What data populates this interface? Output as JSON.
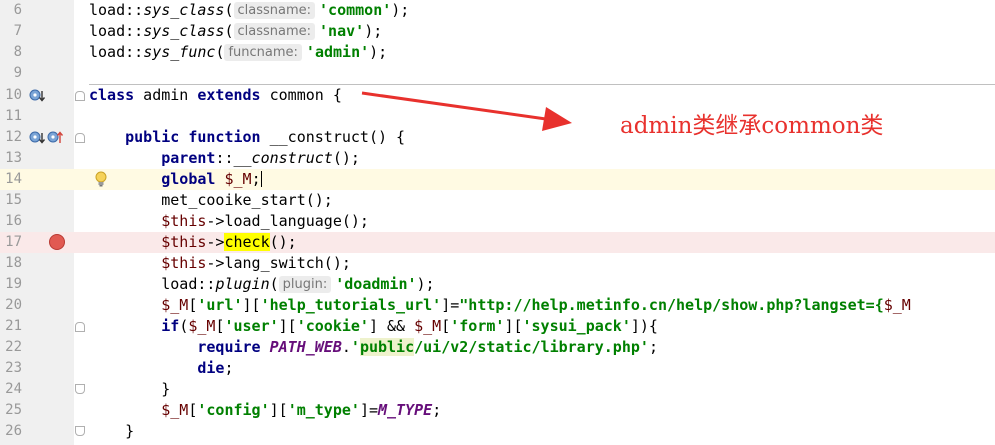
{
  "annotation": {
    "text": "admin类继承common类",
    "color": "#e8312d"
  },
  "gutter_icons": [
    "override-up-icon",
    "implement-icon",
    "bulb-icon",
    "breakpoint-icon"
  ],
  "lines": [
    {
      "num": "6",
      "p": [
        "load::",
        "sys_class",
        "(",
        "classname:",
        "'common'",
        ");"
      ]
    },
    {
      "num": "7",
      "p": [
        "load::",
        "sys_class",
        "(",
        "classname:",
        "'nav'",
        ");"
      ]
    },
    {
      "num": "8",
      "p": [
        "load::",
        "sys_func",
        "(",
        "funcname:",
        "'admin'",
        ");"
      ]
    },
    {
      "num": "9"
    },
    {
      "num": "10",
      "p": [
        "class",
        " admin ",
        "extends",
        " common {"
      ]
    },
    {
      "num": "11"
    },
    {
      "num": "12",
      "p": [
        "    ",
        "public",
        " ",
        "function",
        " __construct() {"
      ]
    },
    {
      "num": "13",
      "p": [
        "        ",
        "parent",
        "::",
        "__construct",
        "();"
      ]
    },
    {
      "num": "14",
      "p": [
        "        ",
        "global",
        " ",
        "$_M",
        ";"
      ]
    },
    {
      "num": "15",
      "p": [
        "        met_cooike_start();"
      ]
    },
    {
      "num": "16",
      "p": [
        "        ",
        "$this",
        "->load_language();"
      ]
    },
    {
      "num": "17",
      "p": [
        "        ",
        "$this",
        "->",
        "check",
        "();"
      ]
    },
    {
      "num": "18",
      "p": [
        "        ",
        "$this",
        "->lang_switch();"
      ]
    },
    {
      "num": "19",
      "p": [
        "        load::",
        "plugin",
        "(",
        "plugin:",
        "'doadmin'",
        ");"
      ]
    },
    {
      "num": "20",
      "p": [
        "        ",
        "$_M",
        "[",
        "'url'",
        "][",
        "'help_tutorials_url'",
        "]=",
        "\"http://help.metinfo.cn/help/show.php?langset={",
        "$_M"
      ]
    },
    {
      "num": "21",
      "p": [
        "        ",
        "if",
        "(",
        "$_M",
        "[",
        "'user'",
        "][",
        "'cookie'",
        "] && ",
        "$_M",
        "[",
        "'form'",
        "][",
        "'sysui_pack'",
        "]){"
      ]
    },
    {
      "num": "22",
      "p": [
        "            ",
        "require",
        " ",
        "PATH_WEB",
        ".",
        "'",
        "public",
        "/ui/v2/static/library.php'",
        ";"
      ]
    },
    {
      "num": "23",
      "p": [
        "            ",
        "die",
        ";"
      ]
    },
    {
      "num": "24",
      "p": [
        "        }"
      ]
    },
    {
      "num": "25",
      "p": [
        "        ",
        "$_M",
        "[",
        "'config'",
        "][",
        "'m_type'",
        "]=",
        "M_TYPE",
        ";"
      ]
    },
    {
      "num": "26",
      "p": [
        "    }"
      ]
    }
  ]
}
